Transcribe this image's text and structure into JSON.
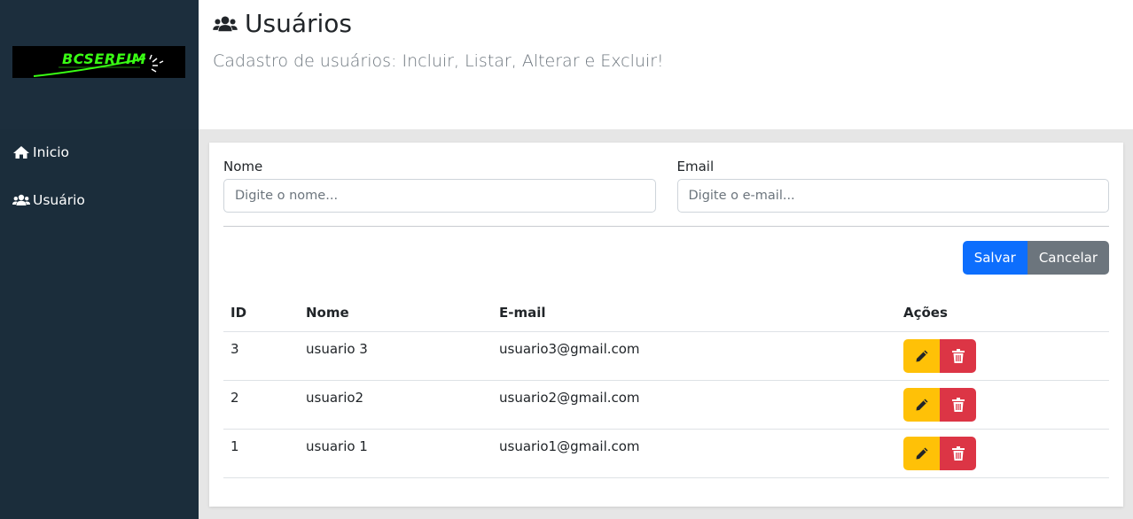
{
  "app": {
    "logo_text": "BCSERFIM"
  },
  "sidebar": {
    "items": [
      {
        "label": "Inicio",
        "icon": "home-icon"
      },
      {
        "label": "Usuário",
        "icon": "users-icon"
      }
    ]
  },
  "header": {
    "title": "Usuários",
    "subtitle": "Cadastro de usuários: Incluir, Listar, Alterar e Excluir!"
  },
  "form": {
    "nome_label": "Nome",
    "nome_placeholder": "Digite o nome...",
    "nome_value": "",
    "email_label": "Email",
    "email_placeholder": "Digite o e-mail...",
    "email_value": "",
    "save_label": "Salvar",
    "cancel_label": "Cancelar"
  },
  "table": {
    "headers": [
      "ID",
      "Nome",
      "E-mail",
      "Ações"
    ],
    "rows": [
      {
        "id": "3",
        "nome": "usuario 3",
        "email": "usuario3@gmail.com"
      },
      {
        "id": "2",
        "nome": "usuario2",
        "email": "usuario2@gmail.com"
      },
      {
        "id": "1",
        "nome": "usuario 1",
        "email": "usuario1@gmail.com"
      }
    ]
  },
  "colors": {
    "sidebar_bg": "#1b2d3b",
    "primary": "#0d6efd",
    "secondary": "#6c757d",
    "warning": "#ffc107",
    "danger": "#dc3545",
    "logo_green": "#39ff14"
  }
}
